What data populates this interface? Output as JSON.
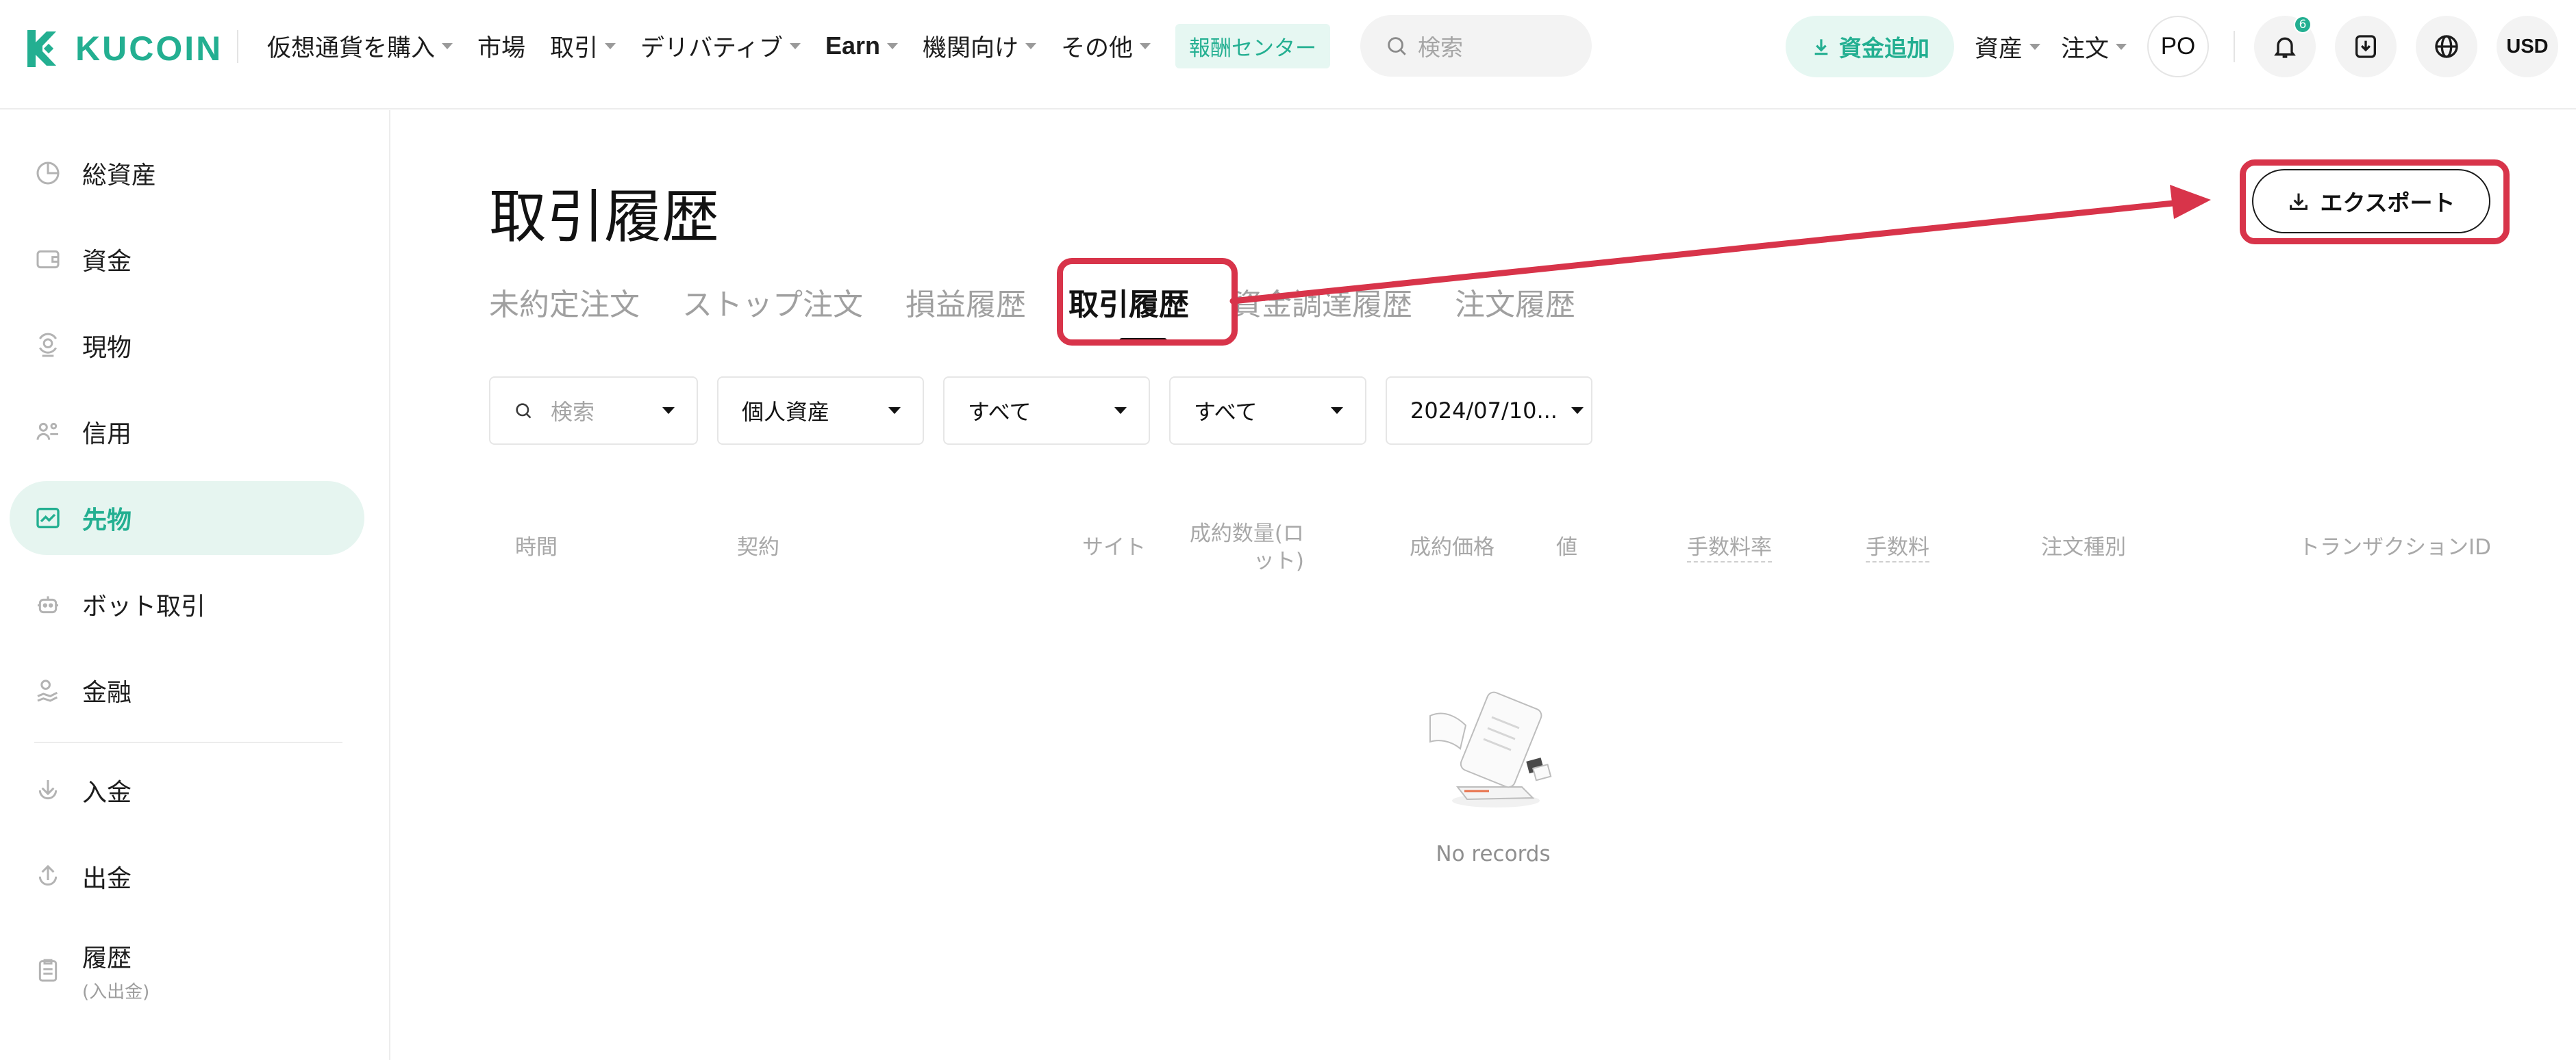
{
  "brand": {
    "name": "KUCOIN",
    "accent_color": "#23af91"
  },
  "topnav": {
    "items": [
      {
        "label": "仮想通貨を購入",
        "has_caret": true
      },
      {
        "label": "市場",
        "has_caret": false
      },
      {
        "label": "取引",
        "has_caret": true
      },
      {
        "label": "デリバティブ",
        "has_caret": true
      },
      {
        "label": "Earn",
        "has_caret": true
      },
      {
        "label": "機関向け",
        "has_caret": true
      },
      {
        "label": "その他",
        "has_caret": true
      }
    ],
    "reward_center": "報酬センター",
    "search_placeholder": "検索",
    "deposit_button": "資金追加",
    "assets_menu": "資産",
    "orders_menu": "注文",
    "avatar_initials": "PO",
    "notification_count": "6",
    "currency": "USD"
  },
  "sidebar": {
    "items": [
      {
        "label": "総資産",
        "icon": "pie-chart-icon",
        "active": false
      },
      {
        "label": "資金",
        "icon": "wallet-icon",
        "active": false
      },
      {
        "label": "現物",
        "icon": "spot-icon",
        "active": false
      },
      {
        "label": "信用",
        "icon": "margin-icon",
        "active": false
      },
      {
        "label": "先物",
        "icon": "futures-chart-icon",
        "active": true
      },
      {
        "label": "ボット取引",
        "icon": "bot-icon",
        "active": false
      },
      {
        "label": "金融",
        "icon": "finance-icon",
        "active": false
      },
      {
        "label": "入金",
        "icon": "deposit-icon",
        "active": false
      },
      {
        "label": "出金",
        "icon": "withdraw-icon",
        "active": false
      },
      {
        "label": "履歴",
        "sub": "(入出金)",
        "icon": "clipboard-icon",
        "active": false
      }
    ]
  },
  "main": {
    "title": "取引履歴",
    "export_button": "エクスポート",
    "tabs": [
      {
        "label": "未約定注文",
        "active": false
      },
      {
        "label": "ストップ注文",
        "active": false
      },
      {
        "label": "損益履歴",
        "active": false
      },
      {
        "label": "取引履歴",
        "active": true
      },
      {
        "label": "資金調達履歴",
        "active": false
      },
      {
        "label": "注文履歴",
        "active": false
      }
    ],
    "filters": {
      "search_placeholder": "検索",
      "account": "個人資産",
      "side": "すべて",
      "type": "すべて",
      "date": "2024/07/10..."
    },
    "table_headers": {
      "time": "時間",
      "contract": "契約",
      "side": "サイト",
      "filled_qty": "成約数量(ロット)",
      "filled_price": "成約価格",
      "value": "値",
      "fee_rate": "手数料率",
      "fee": "手数料",
      "order_type": "注文種別",
      "transaction_id": "トランザクションID"
    },
    "empty_text": "No records"
  },
  "annotation": {
    "highlight_color": "#d8344a"
  }
}
